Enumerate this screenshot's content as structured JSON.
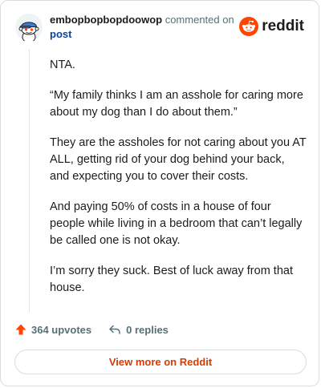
{
  "comment": {
    "username": "embopbopbopdoowop",
    "action_text": "commented on",
    "post_link_label": "post",
    "paragraphs": [
      "NTA.",
      "“My family thinks I am an asshole for caring more about my dog than I do about them.”",
      "They are the assholes for not caring about you AT ALL, getting rid of your dog behind your back, and expecting you to cover their costs.",
      "And paying 50% of costs in a house of four people while living in a bedroom that can’t legally be called one is not okay.",
      "I’m sorry they suck. Best of luck away from that house."
    ]
  },
  "brand": {
    "wordmark": "reddit",
    "icon": "reddit-snoo-icon",
    "color": "#ff4500"
  },
  "actions": {
    "upvotes_label": "364 upvotes",
    "upvote_icon": "upvote-arrow-icon",
    "upvote_color": "#ff4500",
    "replies_label": "0 replies",
    "reply_icon": "reply-arrow-icon"
  },
  "footer": {
    "view_more_label": "View more on Reddit",
    "link_color": "#d93a00"
  }
}
